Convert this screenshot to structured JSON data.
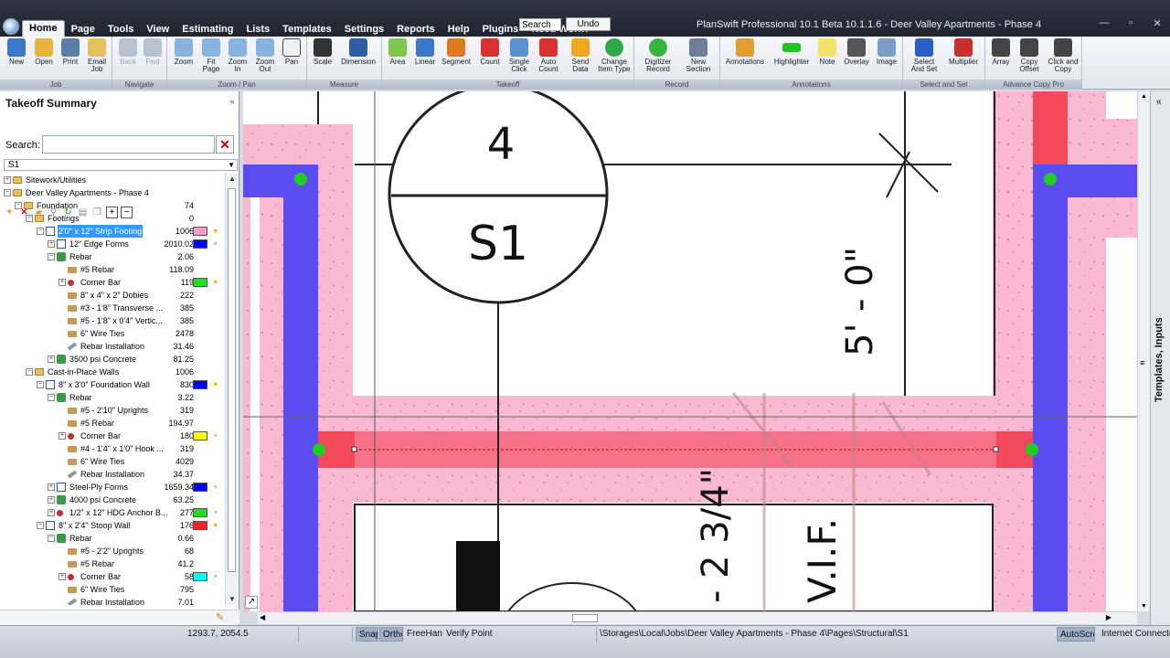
{
  "menu": {
    "items": [
      "Home",
      "Page",
      "Tools",
      "View",
      "Estimating",
      "Lists",
      "Templates",
      "Settings",
      "Reports",
      "Help",
      "Plugins",
      "Need Work?"
    ],
    "search_value": "Search",
    "undo_label": "Undo"
  },
  "window": {
    "title": "PlanSwift Professional 10.1 Beta  10.1.1.6 - Deer Valley Apartments - Phase 4",
    "minimize": "—",
    "maximize": "▫",
    "close": "✕"
  },
  "ribbon": {
    "groups": {
      "job": "Job",
      "navigate": "Navigate",
      "zoom_pan": "Zoom / Pan",
      "measure": "Measure",
      "takeoff": "Takeoff",
      "record": "Record",
      "annotations": "Annotations",
      "select_set": "Select and Set",
      "advance_copy": "Advance Copy Pro"
    },
    "buttons": {
      "new": "New",
      "open": "Open",
      "print": "Print",
      "email_job": "Email Job",
      "back": "Back",
      "fwd": "Fwd",
      "zoom": "Zoom",
      "fit_page": "Fit Page",
      "zoom_in": "Zoom In",
      "zoom_out": "Zoom Out",
      "pan": "Pan",
      "scale": "Scale",
      "dimension": "Dimension",
      "area": "Area",
      "linear": "Linear",
      "segment": "Segment",
      "count": "Count",
      "single_click": "Single Click",
      "auto_count": "Auto Count",
      "send_data": "Send Data",
      "change_item_type": "Change Item Type",
      "digitizer_record": "Digitizer Record",
      "new_section": "New Section",
      "annotations": "Annotations",
      "highlighter": "Highlighter",
      "note": "Note",
      "overlay": "Overlay",
      "image": "Image",
      "select_and_set": "Select And Set",
      "multiplier": "Multiplier",
      "array": "Array",
      "copy_offset": "Copy Offset",
      "click_and_copy": "Click and Copy"
    },
    "colors": {
      "new": "#3a78c8",
      "open": "#e9b43c",
      "print": "#5c7fa8",
      "email": "#e4c15a",
      "nav": "#b9c3d0",
      "zoom": "#8ab4e0",
      "pan": "#f0f0f0",
      "scale": "#333333",
      "dimension": "#2c5ea8",
      "area": "#7ec850",
      "linear": "#3a78c8",
      "segment": "#e07a1f",
      "count": "#d93030",
      "single_click": "#5a8fd0",
      "auto_count": "#d93030",
      "send_data": "#f0a820",
      "change_type": "#2fa84a",
      "digitizer": "#35b540",
      "new_section": "#6c7f96",
      "annotations": "#e0a030",
      "highlighter": "#22c322",
      "note": "#f4e36a",
      "overlay": "#555555",
      "image": "#7a9cc6",
      "select_set": "#2c5ec8",
      "multiplier": "#c83030",
      "array": "#444444",
      "copy_offset": "#444444",
      "click_copy": "#444444"
    }
  },
  "takeoff_summary": {
    "title": "Takeoff Summary",
    "collapse": "«",
    "search_label": "Search:",
    "search_value": "",
    "page": "S1",
    "tree": [
      {
        "d": 1,
        "exp": "+",
        "icon": "folder",
        "name": "Sitework/Utilities",
        "val": "",
        "sw": "",
        "bulb": ""
      },
      {
        "d": 1,
        "exp": "−",
        "icon": "folder",
        "name": "Deer Valley Apartments - Phase 4",
        "val": "",
        "sw": "",
        "bulb": ""
      },
      {
        "d": 2,
        "exp": "−",
        "icon": "folder",
        "name": "Foundation",
        "val": "74",
        "sw": "",
        "bulb": ""
      },
      {
        "d": 3,
        "exp": "−",
        "icon": "folder",
        "name": "Footings",
        "val": "0",
        "sw": "",
        "bulb": ""
      },
      {
        "d": 4,
        "exp": "−",
        "icon": "linear",
        "name": "2'0\" x 12\" Strip Footing",
        "val": "1006",
        "sw": "#ff99cc",
        "bulb": "on",
        "sel": true
      },
      {
        "d": 5,
        "exp": "+",
        "icon": "linear",
        "name": "12\" Edge Forms",
        "val": "2010.02",
        "sw": "#0000ff",
        "bulb": "off"
      },
      {
        "d": 5,
        "exp": "−",
        "icon": "assembly",
        "name": "Rebar",
        "val": "2.06",
        "sw": "",
        "bulb": ""
      },
      {
        "d": 6,
        "exp": "",
        "icon": "part",
        "name": "#5 Rebar",
        "val": "118.09",
        "sw": "",
        "bulb": ""
      },
      {
        "d": 6,
        "exp": "+",
        "icon": "count",
        "name": "Corner Bar",
        "val": "119",
        "sw": "#22dd22",
        "bulb": "on"
      },
      {
        "d": 6,
        "exp": "",
        "icon": "part",
        "name": "8\" x 4\" x 2\" Dobies",
        "val": "222",
        "sw": "",
        "bulb": ""
      },
      {
        "d": 6,
        "exp": "",
        "icon": "part",
        "name": "#3 - 1'8\" Transverse ...",
        "val": "385",
        "sw": "",
        "bulb": ""
      },
      {
        "d": 6,
        "exp": "",
        "icon": "part",
        "name": "#5 - 1'8\" x 0'4\" Vertic...",
        "val": "385",
        "sw": "",
        "bulb": ""
      },
      {
        "d": 6,
        "exp": "",
        "icon": "part",
        "name": "6\" Wire Ties",
        "val": "2478",
        "sw": "",
        "bulb": ""
      },
      {
        "d": 6,
        "exp": "",
        "icon": "tool",
        "name": "Rebar Installation",
        "val": "31.46",
        "sw": "",
        "bulb": ""
      },
      {
        "d": 5,
        "exp": "+",
        "icon": "assembly",
        "name": "3500 psi Concrete",
        "val": "81.25",
        "sw": "",
        "bulb": ""
      },
      {
        "d": 3,
        "exp": "−",
        "icon": "folder",
        "name": "Cast-in-Place Walls",
        "val": "1006",
        "sw": "",
        "bulb": ""
      },
      {
        "d": 4,
        "exp": "−",
        "icon": "linear",
        "name": "8\" x 3'0\" Foundation Wall",
        "val": "830",
        "sw": "#0000ff",
        "bulb": "on"
      },
      {
        "d": 5,
        "exp": "−",
        "icon": "assembly",
        "name": "Rebar",
        "val": "3.22",
        "sw": "",
        "bulb": ""
      },
      {
        "d": 6,
        "exp": "",
        "icon": "part",
        "name": "#5 - 2'10\" Uprights",
        "val": "319",
        "sw": "",
        "bulb": ""
      },
      {
        "d": 6,
        "exp": "",
        "icon": "part",
        "name": "#5 Rebar",
        "val": "194.97",
        "sw": "",
        "bulb": ""
      },
      {
        "d": 6,
        "exp": "+",
        "icon": "count",
        "name": "Corner Bar",
        "val": "180",
        "sw": "#ffff00",
        "bulb": "off"
      },
      {
        "d": 6,
        "exp": "",
        "icon": "part",
        "name": "#4 - 1'4\" x 1'0\" Hook ...",
        "val": "319",
        "sw": "",
        "bulb": ""
      },
      {
        "d": 6,
        "exp": "",
        "icon": "part",
        "name": "6\" Wire Ties",
        "val": "4029",
        "sw": "",
        "bulb": ""
      },
      {
        "d": 6,
        "exp": "",
        "icon": "tool",
        "name": "Rebar Installation",
        "val": "34.37",
        "sw": "",
        "bulb": ""
      },
      {
        "d": 5,
        "exp": "+",
        "icon": "linear",
        "name": "Steel-Ply Forms",
        "val": "1659.34",
        "sw": "#0000ff",
        "bulb": "off"
      },
      {
        "d": 5,
        "exp": "+",
        "icon": "assembly",
        "name": "4000 psi Concrete",
        "val": "63.25",
        "sw": "",
        "bulb": ""
      },
      {
        "d": 5,
        "exp": "+",
        "icon": "count",
        "name": "1/2\" x 12\" HDG Anchor B...",
        "val": "277",
        "sw": "#22dd22",
        "bulb": "off"
      },
      {
        "d": 4,
        "exp": "−",
        "icon": "linear",
        "name": "8\" x 2'4\" Stoop Wall",
        "val": "176",
        "sw": "#ff2020",
        "bulb": "on"
      },
      {
        "d": 5,
        "exp": "−",
        "icon": "assembly",
        "name": "Rebar",
        "val": "0.66",
        "sw": "",
        "bulb": ""
      },
      {
        "d": 6,
        "exp": "",
        "icon": "part",
        "name": "#5 - 2'2\" Uprights",
        "val": "68",
        "sw": "",
        "bulb": ""
      },
      {
        "d": 6,
        "exp": "",
        "icon": "part",
        "name": "#5 Rebar",
        "val": "41.2",
        "sw": "",
        "bulb": ""
      },
      {
        "d": 6,
        "exp": "+",
        "icon": "count",
        "name": "Corner Bar",
        "val": "58",
        "sw": "#00ffff",
        "bulb": "off"
      },
      {
        "d": 6,
        "exp": "",
        "icon": "part",
        "name": "6\" Wire Ties",
        "val": "795",
        "sw": "",
        "bulb": ""
      },
      {
        "d": 6,
        "exp": "",
        "icon": "tool",
        "name": "Rebar Installation",
        "val": "7.01",
        "sw": "",
        "bulb": ""
      }
    ]
  },
  "drawing": {
    "bubble_top": "4",
    "bubble_bottom": "S1",
    "dim_vertical": "5' - 0\"",
    "dim_lower": "- 2 3/4\"",
    "vif": "V.I.F."
  },
  "right_panel": {
    "label": "Templates, Inputs"
  },
  "status": {
    "coords": "1293.7, 2054.5",
    "snap": "Snap",
    "ortho": "Ortho",
    "freehand": "FreeHan",
    "verify": "Verify Point",
    "path": "\\Storages\\Local\\Jobs\\Deer Valley Apartments - Phase 4\\Pages\\Structural\\S1",
    "autoscroll": "AutoScro",
    "internet": "Internet Connected"
  }
}
